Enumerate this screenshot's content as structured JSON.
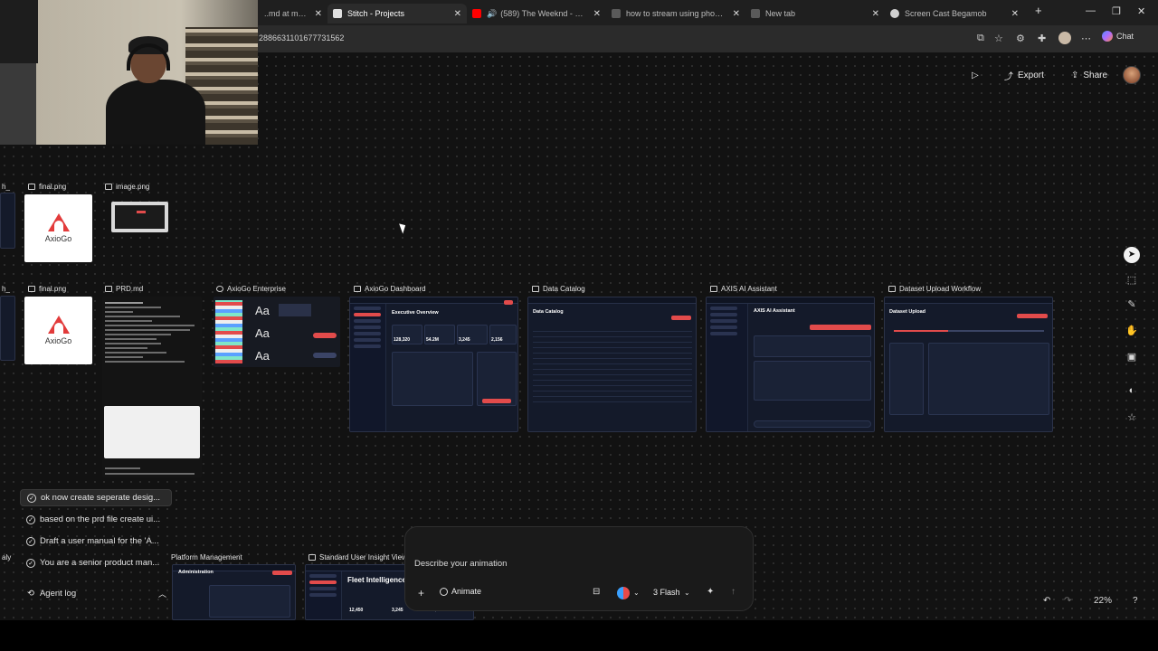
{
  "browser": {
    "tabs": [
      {
        "label": "..md at main · M",
        "active": false,
        "favicon_color": "#6e6e6e"
      },
      {
        "label": "Stitch - Projects",
        "active": true,
        "favicon_color": "#e0e0e0"
      },
      {
        "label": "(589) The Weeknd - Save Yo",
        "active": false,
        "favicon_color": "#ff0000"
      },
      {
        "label": "how to stream using phone usin",
        "active": false,
        "favicon_color": "#5a5a5a"
      },
      {
        "label": "New tab",
        "active": false,
        "favicon_color": "#5a5a5a"
      },
      {
        "label": "Screen Cast Begamob",
        "active": false,
        "favicon_color": "#d0d0d0"
      }
    ],
    "new_tab_label": "+",
    "url": "2886631101677731562",
    "chat_label": "Chat"
  },
  "toolbar": {
    "export_label": "Export",
    "share_label": "Share"
  },
  "cards_row1": [
    {
      "label": "final.png",
      "logo_text": "AxioGo"
    },
    {
      "label": "image.png"
    }
  ],
  "cards_row2": [
    {
      "label": "final.png",
      "logo_text": "AxioGo"
    },
    {
      "label": "PRD.md"
    },
    {
      "label": "AxioGo Enterprise",
      "sample": "Aa"
    },
    {
      "label": "AxioGo Dashboard",
      "heading": "Executive Overview",
      "stats": [
        "128,320",
        "54.2M",
        "3,245",
        "2,156"
      ]
    },
    {
      "label": "Data Catalog",
      "heading": "Data Catalog"
    },
    {
      "label": "AXIS AI Assistant",
      "heading": "AXIS AI Assistant"
    },
    {
      "label": "Dataset Upload Workflow",
      "heading": "Dataset Upload"
    }
  ],
  "cards_row3": [
    {
      "label": "Standard User Insight View",
      "heading": "Fleet Intelligence",
      "stats": [
        "12,450",
        "3,245",
        "$1.2M"
      ]
    },
    {
      "label": "Platform Management",
      "heading": "Administration"
    }
  ],
  "left_cut_labels": [
    "h_",
    "h_",
    "aly"
  ],
  "tasks": [
    {
      "label": "ok now create seperate desig...",
      "selected": true
    },
    {
      "label": "based on the prd file create ui...",
      "selected": false
    },
    {
      "label": "Draft a user manual for the 'A...",
      "selected": false
    },
    {
      "label": "You are a senior product man...",
      "selected": false
    }
  ],
  "agent_log_label": "Agent log",
  "prompt": {
    "placeholder": "Describe your animation",
    "animate_label": "Animate",
    "model_label": "3 Flash"
  },
  "zoom_label": "22%",
  "help_label": "?",
  "colors": {
    "accent_red": "#e24b4b",
    "canvas_bg": "#121212",
    "dash_bg": "#141a2a"
  }
}
